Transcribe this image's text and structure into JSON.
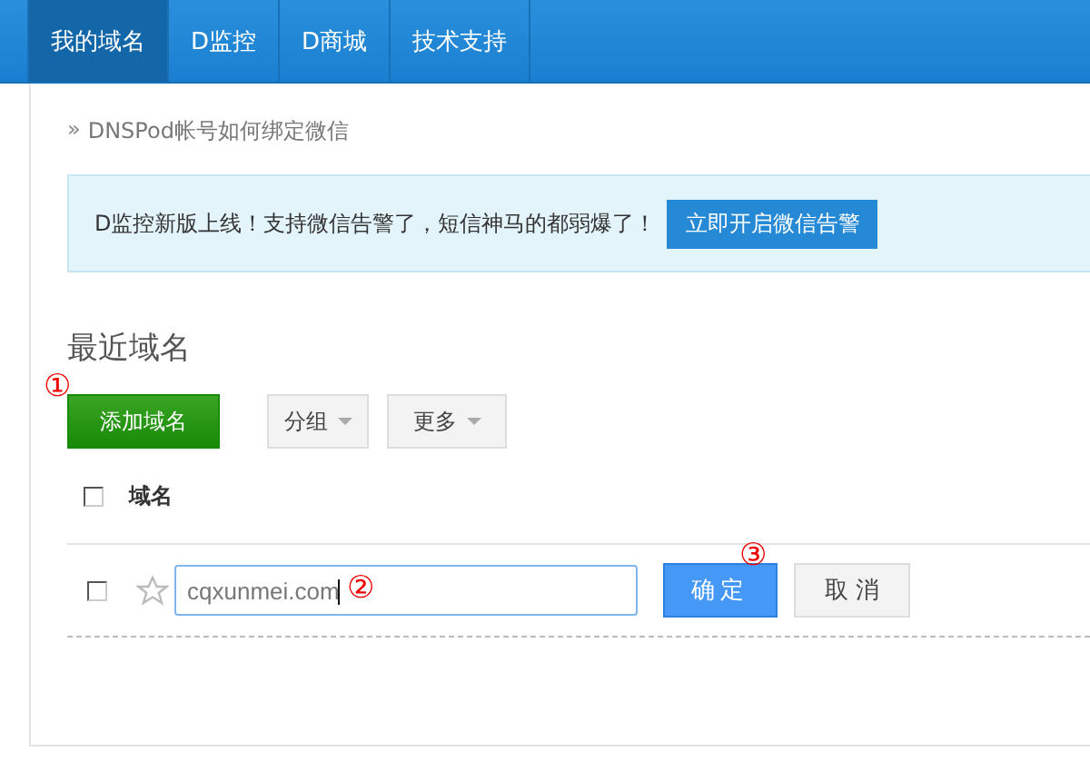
{
  "nav": {
    "tabs": [
      {
        "label": "我的域名",
        "selected": true
      },
      {
        "label": "D监控",
        "selected": false
      },
      {
        "label": "D商城",
        "selected": false
      },
      {
        "label": "技术支持",
        "selected": false
      }
    ]
  },
  "help_link": {
    "marker": "»",
    "text": "DNSPod帐号如何绑定微信"
  },
  "notice": {
    "text": "D监控新版上线！支持微信告警了，短信神马的都弱爆了！",
    "button": "立即开启微信告警"
  },
  "section_title": "最近域名",
  "toolbar": {
    "buttons": [
      {
        "label": "添加域名",
        "kind": "primary",
        "annotation": "①"
      },
      {
        "label": "分组",
        "kind": "dropdown"
      },
      {
        "label": "更多",
        "kind": "dropdown"
      }
    ]
  },
  "table": {
    "header": {
      "checked": false,
      "column": "域名"
    },
    "edit_row": {
      "checked": false,
      "starred": false,
      "value": "cqxunmei.com",
      "value_annotation": "②",
      "confirm": "确定",
      "confirm_annotation": "③",
      "cancel": "取 消"
    }
  }
}
